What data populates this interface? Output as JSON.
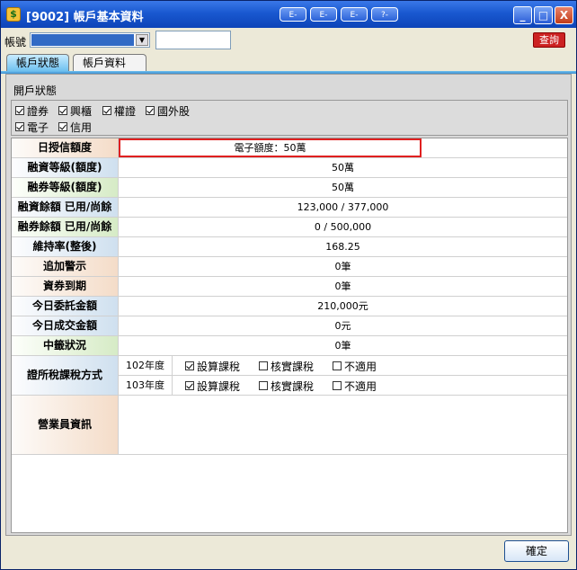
{
  "window": {
    "title": "[9002] 帳戶基本資料"
  },
  "toolbar": {
    "buttons": [
      "E-",
      "E-",
      "E-",
      "?-"
    ]
  },
  "window_controls": {
    "minimize": "_",
    "maximize": "□",
    "close": "X"
  },
  "account": {
    "label": "帳號",
    "query_label": "查詢"
  },
  "tabs": [
    {
      "label": "帳戶狀態",
      "active": true
    },
    {
      "label": "帳戶資料",
      "active": false
    }
  ],
  "open_status": {
    "title": "開戶狀態",
    "checkboxes": [
      {
        "label": "證券",
        "checked": true
      },
      {
        "label": "興櫃",
        "checked": true
      },
      {
        "label": "權證",
        "checked": true
      },
      {
        "label": "國外股",
        "checked": true
      },
      {
        "label": "電子",
        "checked": true
      },
      {
        "label": "信用",
        "checked": true
      }
    ]
  },
  "rows": [
    {
      "label": "日授信額度",
      "value": "電子額度：50萬"
    },
    {
      "label": "融資等級(額度)",
      "value": "50萬"
    },
    {
      "label": "融券等級(額度)",
      "value": "50萬"
    },
    {
      "label": "融資餘額 已用/尚餘",
      "value": "123,000 / 377,000"
    },
    {
      "label": "融券餘額 已用/尚餘",
      "value": "0 / 500,000"
    },
    {
      "label": "維持率(整後)",
      "value": "168.25"
    },
    {
      "label": "追加警示",
      "value": "0筆"
    },
    {
      "label": "資券到期",
      "value": "0筆"
    },
    {
      "label": "今日委託金額",
      "value": "210,000元"
    },
    {
      "label": "今日成交金額",
      "value": "0元"
    },
    {
      "label": "中籤狀況",
      "value": "0筆"
    }
  ],
  "tax": {
    "label": "證所稅課稅方式",
    "years": [
      {
        "year": "102年度",
        "options": [
          {
            "label": "設算課稅",
            "checked": true
          },
          {
            "label": "核實課稅",
            "checked": false
          },
          {
            "label": "不適用",
            "checked": false
          }
        ]
      },
      {
        "year": "103年度",
        "options": [
          {
            "label": "設算課稅",
            "checked": true
          },
          {
            "label": "核實課稅",
            "checked": false
          },
          {
            "label": "不適用",
            "checked": false
          }
        ]
      }
    ]
  },
  "salesperson": {
    "label": "營業員資訊"
  },
  "footer": {
    "ok_label": "確定"
  }
}
